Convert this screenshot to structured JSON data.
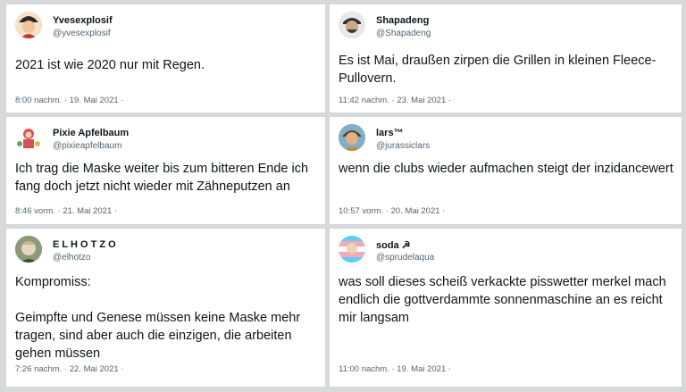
{
  "tweets": [
    {
      "name": "Yvesexplosif",
      "handle": "@yvesexplosif",
      "text": "2021 ist wie 2020 nur mit Regen.",
      "timestamp": "8:00 nachm. · 19. Mai 2021 ·",
      "avatar_color": "#c0392b"
    },
    {
      "name": "Shapadeng",
      "handle": "@Shapadeng",
      "text": "Es ist Mai, draußen zirpen die Grillen in kleinen Fleece-Pullovern.",
      "timestamp": "11:42 nachm. · 23. Mai 2021 ·",
      "avatar_color": "#3a3a3a"
    },
    {
      "name": "Pixie Apfelbaum",
      "handle": "@pixieapfelbaum",
      "text": "Ich trag die Maske weiter bis zum bitteren Ende ich fang doch jetzt nicht wieder mit Zähneputzen an",
      "timestamp": "8:46 vorm. · 21. Mai 2021 ·",
      "avatar_color": "#d35454"
    },
    {
      "name": "lars™",
      "handle": "@jurassiclars",
      "text": "wenn die clubs wieder aufmachen steigt der inzidancewert",
      "timestamp": "10:57 vorm. · 20. Mai 2021 ·",
      "avatar_color": "#c58a3a"
    },
    {
      "name": "E L H O T Z O",
      "handle": "@elhotzo",
      "text": "Kompromiss:\n\nGeimpfte und Genese müssen keine Maske mehr tragen, sind aber auch die einzigen, die arbeiten gehen müssen",
      "timestamp": "7:26 nachm. · 22. Mai 2021 ·",
      "avatar_color": "#6b7a5a"
    },
    {
      "name": "soda ☭",
      "handle": "@sprudelaqua",
      "text": "was soll dieses scheiß verkackte pisswetter merkel mach endlich die gottverdammte sonnenmaschine an es reicht mir langsam",
      "timestamp": "11:00 nachm. · 19. Mai 2021 ·",
      "avatar_color": "#7fd6e6"
    }
  ]
}
